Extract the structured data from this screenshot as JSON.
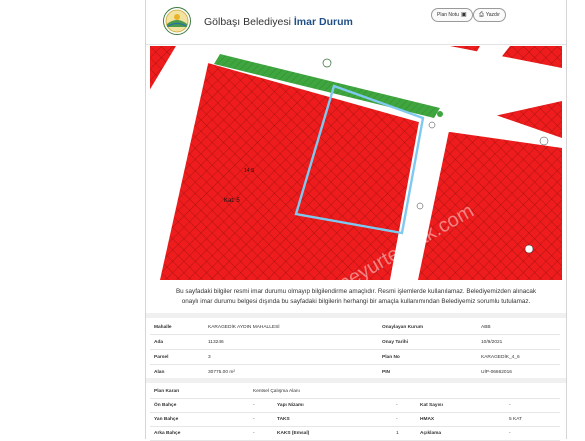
{
  "header": {
    "municipality": "Gölbaşı Belediyesi",
    "section_title": "İmar Durum",
    "plan_notu_label": "Plan Notu",
    "yazdir_label": "Yazdır"
  },
  "map": {
    "watermark": "www.tepeyurtemlak.com",
    "zone_label_1": "14 S\nKat: 5",
    "colors": {
      "zone": "#ee1c1c",
      "road": "#ffffff",
      "green": "#3fa63f",
      "parcel": "#7fc9f0"
    }
  },
  "notice": {
    "line1": "Bu sayfadaki bilgiler resmi imar durumu olmayıp bilgilendirme amaçlıdır. Resmi işlemlerde kullanılamaz. Belediyemizden alınacak",
    "line2": "onaylı imar durumu belgesi dışında bu sayfadaki bilgilerin herhangi bir amaçla kullanımından Belediyemiz sorumlu tutulamaz."
  },
  "parcel_info": {
    "rows": [
      {
        "k1": "Mahalle",
        "v1": "KARAGEDİK AYDIN MAHALLESİ",
        "k2": "Onaylayan Kurum",
        "v2": "ABB"
      },
      {
        "k1": "Ada",
        "v1": "113246",
        "k2": "Onay Tarihi",
        "v2": "10/9/2021"
      },
      {
        "k1": "Parsel",
        "v1": "3",
        "k2": "Plan No",
        "v2": "KARAGEDİK_4_6"
      },
      {
        "k1": "Alan",
        "v1": "30775.00 m²",
        "k2": "PIN",
        "v2": "UİP-06662016"
      }
    ]
  },
  "plan_info": {
    "plan_karari_label": "Plan Kararı",
    "plan_karari_value": "Kentsel Çalışma Alanı",
    "rows": [
      {
        "k1": "Ön Bahçe",
        "v1": "-",
        "k2": "Yapı Nizamı",
        "v2": "-",
        "k3": "Kat Sayısı",
        "v3": "-"
      },
      {
        "k1": "Yan Bahçe",
        "v1": "-",
        "k2": "TAKS",
        "v2": "-",
        "k3": "HMAX",
        "v3": "5 KAT"
      },
      {
        "k1": "Arka Bahçe",
        "v1": "-",
        "k2": "KAKS (Emsal)",
        "v2": "1",
        "k3": "Açıklama",
        "v3": "-"
      }
    ]
  }
}
